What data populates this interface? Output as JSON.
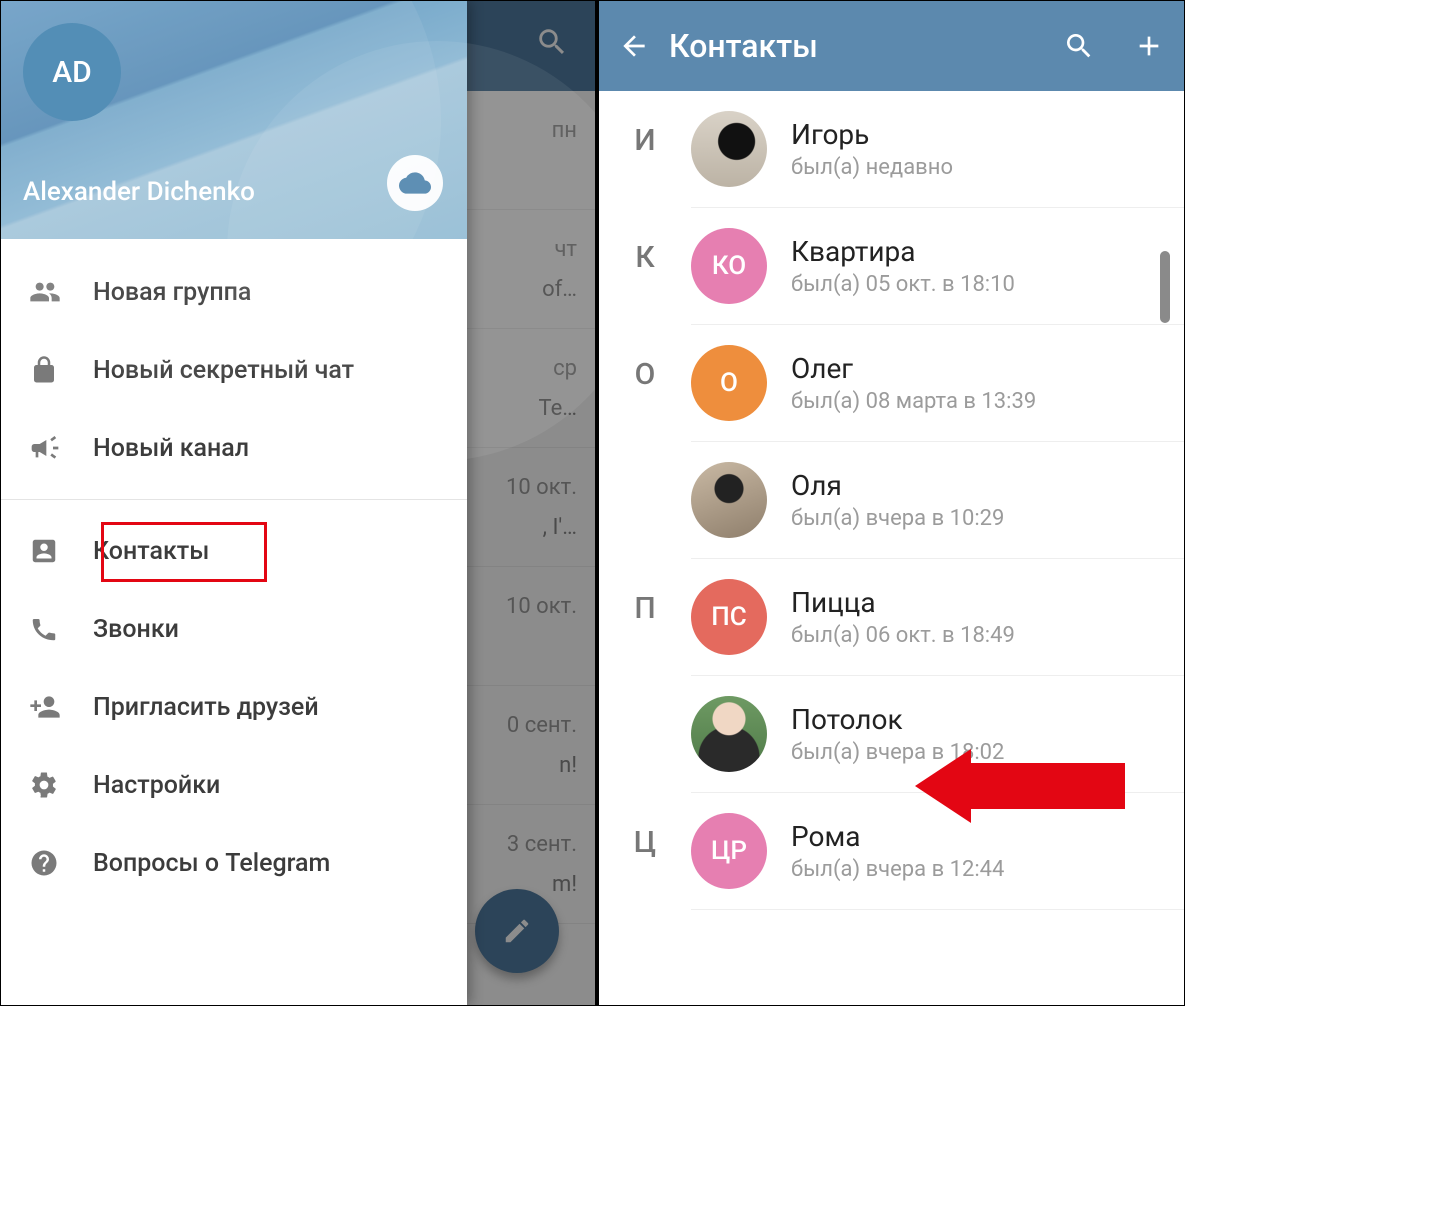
{
  "left": {
    "avatar_initials": "AD",
    "username": "Alexander Dichenko",
    "menu": {
      "new_group": "Новая группа",
      "secret_chat": "Новый секретный чат",
      "new_channel": "Новый канал",
      "contacts": "Контакты",
      "calls": "Звонки",
      "invite": "Пригласить друзей",
      "settings": "Настройки",
      "faq": "Вопросы о Telegram"
    },
    "chat_dates": [
      "пн",
      "чт",
      "ср",
      "10 окт.",
      "10 окт.",
      "0 сент.",
      "3 сент."
    ],
    "chat_snippets": [
      "",
      "of…",
      "Te…",
      ", I'…",
      "",
      "n!",
      "m!"
    ]
  },
  "right": {
    "title": "Контакты",
    "sections": [
      {
        "letter": "И",
        "contacts": [
          {
            "name": "Игорь",
            "status": "был(а) недавно",
            "avatar_type": "photo1",
            "avatar_text": ""
          }
        ]
      },
      {
        "letter": "К",
        "contacts": [
          {
            "name": "Квартира",
            "status": "был(а) 05 окт. в 18:10",
            "avatar_type": "color",
            "avatar_bg": "#E67FB1",
            "avatar_text": "КО"
          }
        ]
      },
      {
        "letter": "О",
        "contacts": [
          {
            "name": "Олег",
            "status": "был(а) 08 марта в 13:39",
            "avatar_type": "color",
            "avatar_bg": "#EE8E3D",
            "avatar_text": "О"
          },
          {
            "name": "Оля",
            "status": "был(а) вчера в 10:29",
            "avatar_type": "photo2",
            "avatar_text": ""
          }
        ]
      },
      {
        "letter": "П",
        "contacts": [
          {
            "name": "Пицца",
            "status": "был(а) 06 окт. в 18:49",
            "avatar_type": "color",
            "avatar_bg": "#E46A5E",
            "avatar_text": "ПС"
          },
          {
            "name": "Потолок",
            "status": "был(а) вчера в 18:02",
            "avatar_type": "photo3",
            "avatar_text": ""
          }
        ]
      },
      {
        "letter": "Ц",
        "contacts": [
          {
            "name": "Рома",
            "status": "был(а) вчера в 12:44",
            "avatar_type": "color",
            "avatar_bg": "#E67FB1",
            "avatar_text": "ЦР"
          }
        ]
      }
    ]
  }
}
